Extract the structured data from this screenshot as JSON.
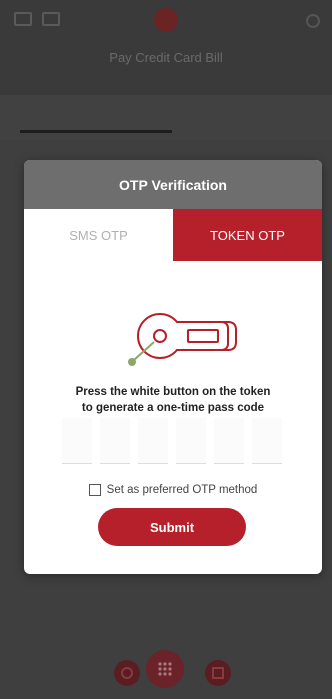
{
  "background": {
    "page_title": "Pay Credit Card Bill",
    "tabs": [
      "",
      ""
    ]
  },
  "modal": {
    "title": "OTP Verification",
    "tabs": {
      "sms": "SMS OTP",
      "token": "TOKEN OTP",
      "active": "token"
    },
    "instruction_line1": "Press the white button on the token",
    "instruction_line2": "to generate a one-time pass code",
    "code_length": 6,
    "preferred_label": "Set as preferred OTP method",
    "preferred_checked": false,
    "submit_label": "Submit"
  },
  "colors": {
    "brand_red": "#b6202a",
    "header_gray": "#6e6e6e",
    "token_accent_green": "#8aa86a"
  },
  "icons": {
    "menu": "menu-icon",
    "card": "card-icon",
    "logo": "bank-logo-icon",
    "token": "security-token-icon",
    "nav_left": "phone-icon",
    "nav_center": "grid-menu-icon",
    "nav_right": "qr-icon"
  }
}
